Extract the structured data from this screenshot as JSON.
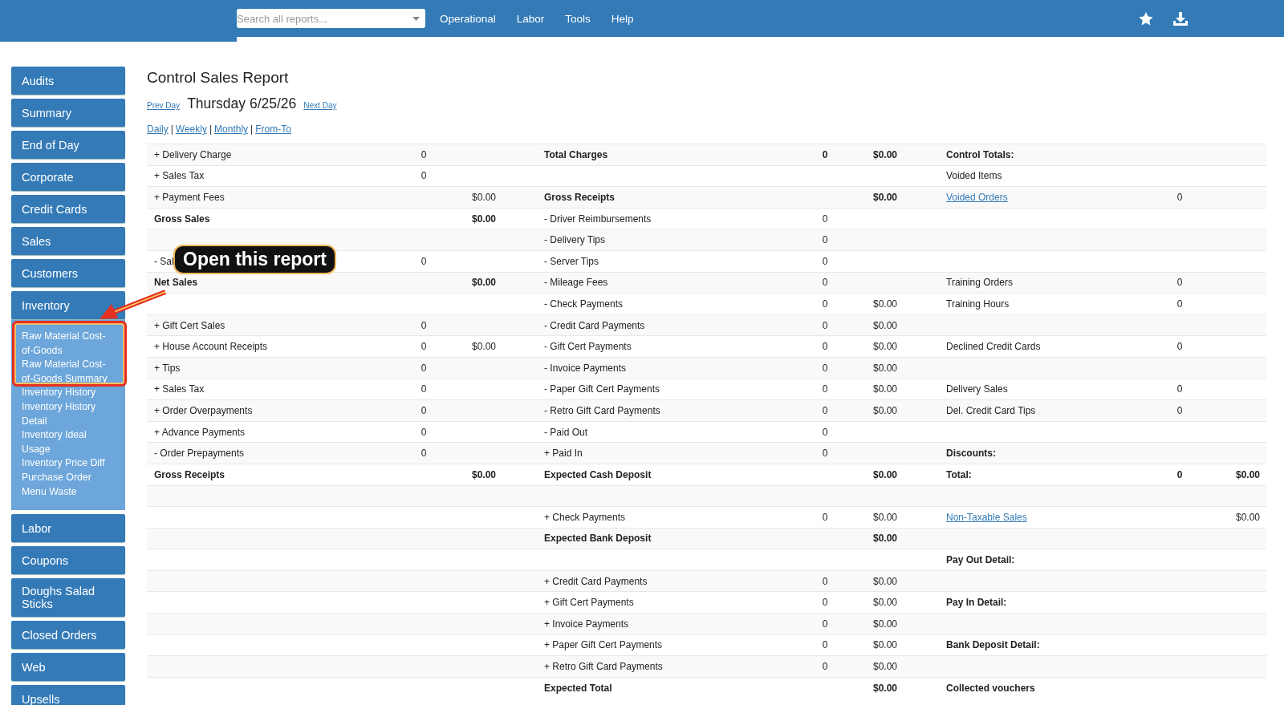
{
  "topbar": {
    "search": {
      "placeholder": "Search all reports..."
    },
    "nav": [
      "Operational",
      "Labor",
      "Tools",
      "Help"
    ]
  },
  "sidebar": {
    "items": [
      {
        "label": "Audits"
      },
      {
        "label": "Summary"
      },
      {
        "label": "End of Day"
      },
      {
        "label": "Corporate"
      },
      {
        "label": "Credit Cards"
      },
      {
        "label": "Sales"
      },
      {
        "label": "Customers"
      },
      {
        "label": "Inventory",
        "children": [
          "Raw Material Cost-of-Goods",
          "Raw Material Cost-of-Goods Summary",
          "Inventory History",
          "Inventory History Detail",
          "Inventory Ideal Usage",
          "Inventory Price Diff",
          "Purchase Order",
          "Menu Waste"
        ]
      },
      {
        "label": "Labor"
      },
      {
        "label": "Coupons"
      },
      {
        "label": "Doughs Salad Sticks"
      },
      {
        "label": "Closed Orders"
      },
      {
        "label": "Web"
      },
      {
        "label": "Upsells"
      }
    ]
  },
  "report": {
    "title": "Control Sales Report",
    "prev": "Prev Day",
    "date": "Thursday 6/25/26",
    "next": "Next Day",
    "periods": [
      "Daily",
      "Weekly",
      "Monthly",
      "From-To"
    ],
    "separator": "|",
    "rows": [
      {
        "left": {
          "label": "+ Delivery Charge",
          "count": "0",
          "kind": "plain"
        },
        "middle": {
          "label": "Total Charges",
          "count": "0",
          "amount": "$0.00",
          "kind": "bold"
        },
        "right": {
          "label": "Control Totals:",
          "kind": "bold"
        }
      },
      {
        "left": {
          "label": "+ Sales Tax",
          "count": "0",
          "kind": "plain"
        },
        "right": {
          "label": "Voided Items",
          "kind": "plain"
        }
      },
      {
        "left": {
          "label": "+ Payment Fees",
          "amount": "$0.00",
          "kind": "plain"
        },
        "middle": {
          "label": "Gross Receipts",
          "amount": "$0.00",
          "kind": "bold"
        },
        "right": {
          "label": "Voided Orders",
          "count": "0",
          "kind": "link"
        }
      },
      {
        "left": {
          "label": "Gross Sales",
          "amount": "$0.00",
          "kind": "bold"
        },
        "middle": {
          "label": "- Driver Reimbursements",
          "count": "0",
          "kind": "plain"
        }
      },
      {
        "middle": {
          "label": "- Delivery Tips",
          "count": "0",
          "kind": "plain"
        }
      },
      {
        "left": {
          "label": "- Sal",
          "count": "0",
          "kind": "plain"
        },
        "middle": {
          "label": "- Server Tips",
          "count": "0",
          "kind": "plain"
        }
      },
      {
        "left": {
          "label": "Net Sales",
          "amount": "$0.00",
          "kind": "bold"
        },
        "middle": {
          "label": "- Mileage Fees",
          "count": "0",
          "kind": "plain"
        },
        "right": {
          "label": "Training Orders",
          "count": "0",
          "kind": "plain"
        }
      },
      {
        "middle": {
          "label": "- Check Payments",
          "count": "0",
          "amount": "$0.00",
          "kind": "plain"
        },
        "right": {
          "label": "Training Hours",
          "count": "0",
          "kind": "plain"
        }
      },
      {
        "left": {
          "label": "+ Gift Cert Sales",
          "count": "0",
          "kind": "plain"
        },
        "middle": {
          "label": "- Credit Card Payments",
          "count": "0",
          "amount": "$0.00",
          "kind": "plain"
        }
      },
      {
        "left": {
          "label": "+ House Account Receipts",
          "count": "0",
          "amount": "$0.00",
          "kind": "plain"
        },
        "middle": {
          "label": "- Gift Cert Payments",
          "count": "0",
          "amount": "$0.00",
          "kind": "plain"
        },
        "right": {
          "label": "Declined Credit Cards",
          "count": "0",
          "kind": "plain"
        }
      },
      {
        "left": {
          "label": "+ Tips",
          "count": "0",
          "kind": "plain"
        },
        "middle": {
          "label": "- Invoice Payments",
          "count": "0",
          "amount": "$0.00",
          "kind": "plain"
        }
      },
      {
        "left": {
          "label": "+ Sales Tax",
          "count": "0",
          "kind": "plain"
        },
        "middle": {
          "label": "- Paper Gift Cert Payments",
          "count": "0",
          "amount": "$0.00",
          "kind": "plain"
        },
        "right": {
          "label": "Delivery Sales",
          "count": "0",
          "kind": "plain"
        }
      },
      {
        "left": {
          "label": "+ Order Overpayments",
          "count": "0",
          "kind": "plain"
        },
        "middle": {
          "label": "- Retro Gift Card Payments",
          "count": "0",
          "amount": "$0.00",
          "kind": "plain"
        },
        "right": {
          "label": "Del. Credit Card Tips",
          "count": "0",
          "kind": "plain"
        }
      },
      {
        "left": {
          "label": "+ Advance Payments",
          "count": "0",
          "kind": "plain"
        },
        "middle": {
          "label": "- Paid Out",
          "count": "0",
          "kind": "plain"
        }
      },
      {
        "left": {
          "label": "- Order Prepayments",
          "count": "0",
          "kind": "plain"
        },
        "middle": {
          "label": "+ Paid In",
          "count": "0",
          "kind": "plain"
        },
        "right": {
          "label": "Discounts:",
          "kind": "bold"
        }
      },
      {
        "left": {
          "label": "Gross Receipts",
          "amount": "$0.00",
          "kind": "bold"
        },
        "middle": {
          "label": "Expected Cash Deposit",
          "amount": "$0.00",
          "kind": "bold"
        },
        "right": {
          "label": "Total:",
          "count": "0",
          "amount": "$0.00",
          "kind": "bold"
        }
      },
      {},
      {
        "middle": {
          "label": "+ Check Payments",
          "count": "0",
          "amount": "$0.00",
          "kind": "plain"
        },
        "right": {
          "label": "Non-Taxable Sales",
          "amount": "$0.00",
          "kind": "link"
        }
      },
      {
        "middle": {
          "label": "Expected Bank Deposit",
          "amount": "$0.00",
          "kind": "bold"
        }
      },
      {
        "right": {
          "label": "Pay Out Detail:",
          "kind": "bold"
        }
      },
      {
        "middle": {
          "label": "+ Credit Card Payments",
          "count": "0",
          "amount": "$0.00",
          "kind": "plain"
        }
      },
      {
        "middle": {
          "label": "+ Gift Cert Payments",
          "count": "0",
          "amount": "$0.00",
          "kind": "plain"
        },
        "right": {
          "label": "Pay In Detail:",
          "kind": "bold"
        }
      },
      {
        "middle": {
          "label": "+ Invoice Payments",
          "count": "0",
          "amount": "$0.00",
          "kind": "plain"
        }
      },
      {
        "middle": {
          "label": "+ Paper Gift Cert Payments",
          "count": "0",
          "amount": "$0.00",
          "kind": "plain"
        },
        "right": {
          "label": "Bank Deposit Detail:",
          "kind": "bold"
        }
      },
      {
        "middle": {
          "label": "+ Retro Gift Card Payments",
          "count": "0",
          "amount": "$0.00",
          "kind": "plain"
        }
      },
      {
        "middle": {
          "label": "Expected Total",
          "amount": "$0.00",
          "kind": "bold"
        },
        "right": {
          "label": "Collected vouchers",
          "kind": "bold"
        }
      }
    ]
  },
  "annotation": {
    "text": "Open this report"
  }
}
